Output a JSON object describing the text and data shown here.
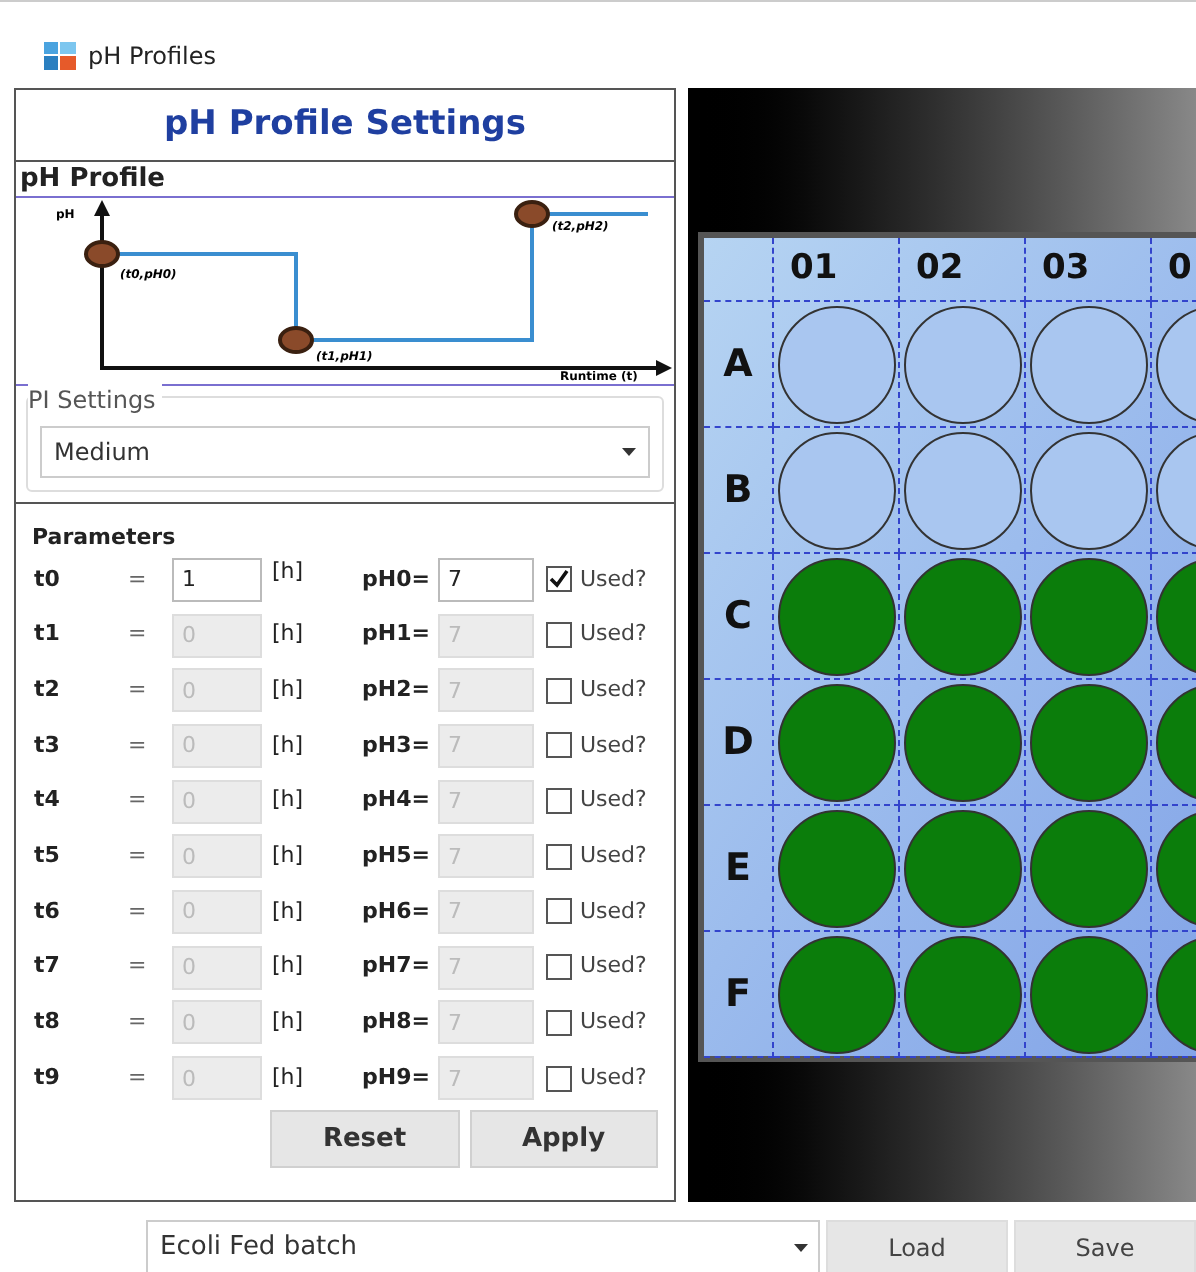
{
  "window": {
    "title": "pH Profiles"
  },
  "panel": {
    "title": "pH Profile Settings",
    "section": "pH Profile",
    "profile": {
      "y_axis": "pH",
      "x_axis": "Runtime (t)",
      "points": [
        {
          "label": "(t0,pH0)"
        },
        {
          "label": "(t1,pH1)"
        },
        {
          "label": "(t2,pH2)"
        }
      ]
    },
    "pi_settings": {
      "legend": "PI Settings",
      "value": "Medium"
    },
    "parameters": {
      "heading": "Parameters",
      "rows": [
        {
          "t_label": "t0",
          "eq": "=",
          "t_value": "1",
          "unit": "[h]",
          "ph_label": "pH0=",
          "ph_value": "7",
          "disabled": false,
          "used": true,
          "used_label": "Used?"
        },
        {
          "t_label": "t1",
          "eq": "=",
          "t_value": "0",
          "unit": "[h]",
          "ph_label": "pH1=",
          "ph_value": "7",
          "disabled": true,
          "used": false,
          "used_label": "Used?"
        },
        {
          "t_label": "t2",
          "eq": "=",
          "t_value": "0",
          "unit": "[h]",
          "ph_label": "pH2=",
          "ph_value": "7",
          "disabled": true,
          "used": false,
          "used_label": "Used?"
        },
        {
          "t_label": "t3",
          "eq": "=",
          "t_value": "0",
          "unit": "[h]",
          "ph_label": "pH3=",
          "ph_value": "7",
          "disabled": true,
          "used": false,
          "used_label": "Used?"
        },
        {
          "t_label": "t4",
          "eq": "=",
          "t_value": "0",
          "unit": "[h]",
          "ph_label": "pH4=",
          "ph_value": "7",
          "disabled": true,
          "used": false,
          "used_label": "Used?"
        },
        {
          "t_label": "t5",
          "eq": "=",
          "t_value": "0",
          "unit": "[h]",
          "ph_label": "pH5=",
          "ph_value": "7",
          "disabled": true,
          "used": false,
          "used_label": "Used?"
        },
        {
          "t_label": "t6",
          "eq": "=",
          "t_value": "0",
          "unit": "[h]",
          "ph_label": "pH6=",
          "ph_value": "7",
          "disabled": true,
          "used": false,
          "used_label": "Used?"
        },
        {
          "t_label": "t7",
          "eq": "=",
          "t_value": "0",
          "unit": "[h]",
          "ph_label": "pH7=",
          "ph_value": "7",
          "disabled": true,
          "used": false,
          "used_label": "Used?"
        },
        {
          "t_label": "t8",
          "eq": "=",
          "t_value": "0",
          "unit": "[h]",
          "ph_label": "pH8=",
          "ph_value": "7",
          "disabled": true,
          "used": false,
          "used_label": "Used?"
        },
        {
          "t_label": "t9",
          "eq": "=",
          "t_value": "0",
          "unit": "[h]",
          "ph_label": "pH9=",
          "ph_value": "7",
          "disabled": true,
          "used": false,
          "used_label": "Used?"
        }
      ]
    },
    "buttons": [
      "Reset",
      "Apply"
    ]
  },
  "plate": {
    "columns": [
      "01",
      "02",
      "03",
      "0"
    ],
    "rows": [
      {
        "label": "A",
        "wells": [
          {
            "filled": false
          },
          {
            "filled": false
          },
          {
            "filled": false
          },
          {
            "filled": false
          }
        ]
      },
      {
        "label": "B",
        "wells": [
          {
            "filled": false
          },
          {
            "filled": false
          },
          {
            "filled": false
          },
          {
            "filled": false
          }
        ]
      },
      {
        "label": "C",
        "wells": [
          {
            "filled": true
          },
          {
            "filled": true
          },
          {
            "filled": true
          },
          {
            "filled": true
          }
        ]
      },
      {
        "label": "D",
        "wells": [
          {
            "filled": true
          },
          {
            "filled": true
          },
          {
            "filled": true
          },
          {
            "filled": true
          }
        ]
      },
      {
        "label": "E",
        "wells": [
          {
            "filled": true
          },
          {
            "filled": true
          },
          {
            "filled": true
          },
          {
            "filled": true
          }
        ]
      },
      {
        "label": "F",
        "wells": [
          {
            "filled": true
          },
          {
            "filled": true
          },
          {
            "filled": true
          },
          {
            "filled": true
          }
        ]
      }
    ]
  },
  "bottom": {
    "profile": "Ecoli Fed batch",
    "buttons": [
      "Load",
      "Save"
    ]
  }
}
